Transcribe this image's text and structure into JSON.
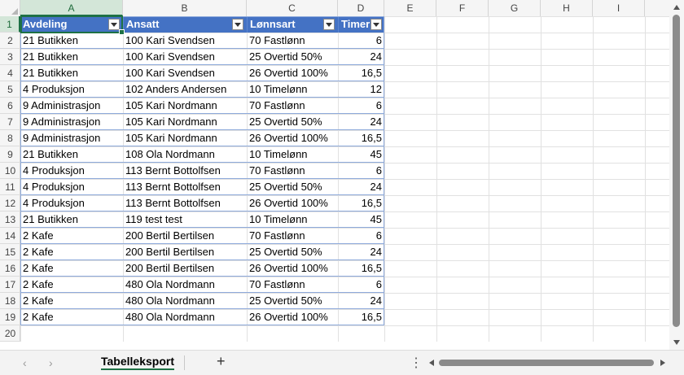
{
  "columns": [
    "A",
    "B",
    "C",
    "D",
    "E",
    "F",
    "G",
    "H",
    "I"
  ],
  "row_numbers": [
    "1",
    "2",
    "3",
    "4",
    "5",
    "6",
    "7",
    "8",
    "9",
    "10",
    "11",
    "12",
    "13",
    "14",
    "15",
    "16",
    "17",
    "18",
    "19",
    "20"
  ],
  "table": {
    "headers": [
      "Avdeling",
      "Ansatt",
      "Lønnsart",
      "Timer"
    ],
    "rows": [
      [
        "21 Butikken",
        "100 Kari Svendsen",
        "70 Fastlønn",
        "6"
      ],
      [
        "21 Butikken",
        "100 Kari Svendsen",
        "25 Overtid 50%",
        "24"
      ],
      [
        "21 Butikken",
        "100 Kari Svendsen",
        "26 Overtid 100%",
        "16,5"
      ],
      [
        "4 Produksjon",
        "102 Anders Andersen",
        "10 Timelønn",
        "12"
      ],
      [
        "9 Administrasjon",
        "105 Kari Nordmann",
        "70 Fastlønn",
        "6"
      ],
      [
        "9 Administrasjon",
        "105 Kari Nordmann",
        "25 Overtid 50%",
        "24"
      ],
      [
        "9 Administrasjon",
        "105 Kari Nordmann",
        "26 Overtid 100%",
        "16,5"
      ],
      [
        "21 Butikken",
        "108 Ola Nordmann",
        "10 Timelønn",
        "45"
      ],
      [
        "4 Produksjon",
        "113 Bernt Bottolfsen",
        "70 Fastlønn",
        "6"
      ],
      [
        "4 Produksjon",
        "113 Bernt Bottolfsen",
        "25 Overtid 50%",
        "24"
      ],
      [
        "4 Produksjon",
        "113 Bernt Bottolfsen",
        "26 Overtid 100%",
        "16,5"
      ],
      [
        "21 Butikken",
        "119 test test",
        "10 Timelønn",
        "45"
      ],
      [
        "2 Kafe",
        "200 Bertil Bertilsen",
        "70 Fastlønn",
        "6"
      ],
      [
        "2 Kafe",
        "200 Bertil Bertilsen",
        "25 Overtid 50%",
        "24"
      ],
      [
        "2 Kafe",
        "200 Bertil Bertilsen",
        "26 Overtid 100%",
        "16,5"
      ],
      [
        "2 Kafe",
        "480 Ola Nordmann",
        "70 Fastlønn",
        "6"
      ],
      [
        "2 Kafe",
        "480 Ola Nordmann",
        "25 Overtid 50%",
        "24"
      ],
      [
        "2 Kafe",
        "480 Ola Nordmann",
        "26 Overtid 100%",
        "16,5"
      ]
    ]
  },
  "sheet_tab": "Tabelleksport",
  "icons": {
    "prev_sheet": "chevron-left-icon",
    "next_sheet": "chevron-right-icon",
    "add_sheet": "plus-icon",
    "more": "vertical-ellipsis-icon"
  },
  "glyphs": {
    "prev": "‹",
    "next": "›",
    "add": "+",
    "more": "⋮"
  },
  "colors": {
    "table_header": "#4472c4",
    "selection": "#1e7145",
    "table_border": "#8eaadb"
  }
}
